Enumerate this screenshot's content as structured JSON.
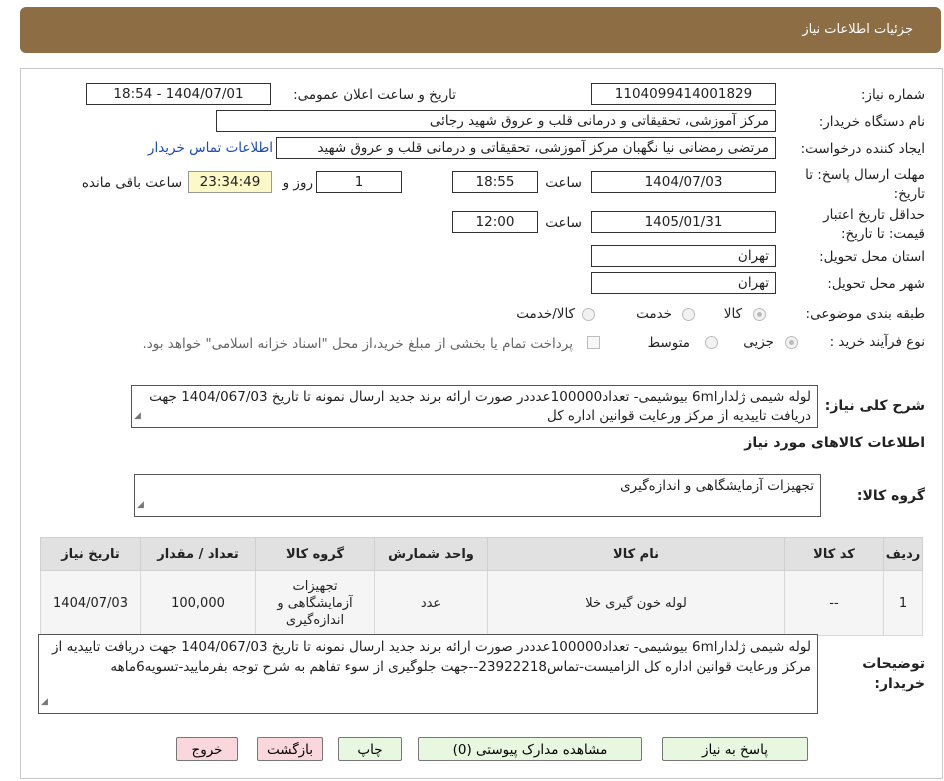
{
  "header": {
    "title": "جزئيات اطلاعات نياز"
  },
  "fields": {
    "need_number": {
      "label": "شماره نیاز:",
      "value": "1104099414001829"
    },
    "announce_datetime": {
      "label": "تاریخ و ساعت اعلان عمومی:",
      "value": "1404/07/01 - 18:54"
    },
    "buyer_org": {
      "label": "نام دستگاه خریدار:",
      "value": "مرکز آموزشی، تحقیقاتی و درمانی قلب و عروق شهید رجائی"
    },
    "requester": {
      "label": "ایجاد کننده درخواست:",
      "value": "مرتضی رمضانی نیا نگهبان مرکز آموزشی، تحقیقاتی و درمانی قلب و عروق شهید",
      "contact_link": "اطلاعات تماس خریدار"
    },
    "deadline": {
      "label_line1": "مهلت ارسال پاسخ: تا",
      "label_line2": "تاریخ:",
      "date": "1404/07/03",
      "time_label": "ساعت",
      "time": "18:55",
      "days": "1",
      "days_label": "روز و",
      "remaining": "23:34:49",
      "remaining_label": "ساعت باقی مانده"
    },
    "validity": {
      "label_line1": "حداقل تاریخ اعتبار",
      "label_line2": "قیمت: تا تاریخ:",
      "date": "1405/01/31",
      "time_label": "ساعت",
      "time": "12:00"
    },
    "province": {
      "label": "استان محل تحویل:",
      "value": "تهران"
    },
    "city": {
      "label": "شهر محل تحویل:",
      "value": "تهران"
    },
    "category": {
      "label": "طبقه بندی موضوعی:",
      "options": [
        "کالا",
        "خدمت",
        "کالا/خدمت"
      ]
    },
    "process": {
      "label": "نوع فرآیند خرید :",
      "options": [
        "جزیی",
        "متوسط"
      ],
      "payment_note": "پرداخت تمام یا بخشی از مبلغ خرید،از محل \"اسناد خزانه اسلامی\" خواهد بود."
    }
  },
  "description": {
    "label": "شرح کلی نیاز:",
    "text": "لوله شیمی ژلدار6ml بیوشیمی- تعداد100000عدددر صورت ارائه برند جدید ارسال نمونه تا تاریخ 1404/067/03 جهت دریافت تاییدیه از مرکز ورعایت قوانین اداره کل"
  },
  "goods_section": {
    "title": "اطلاعات کالاهای مورد نیاز",
    "group_label": "گروه کالا:",
    "group_value": "تجهیزات آزمایشگاهی و اندازه‌گیری"
  },
  "table": {
    "headers": [
      "ردیف",
      "کد کالا",
      "نام کالا",
      "واحد شمارش",
      "گروه کالا",
      "تعداد / مقدار",
      "تاریخ نیاز"
    ],
    "rows": [
      {
        "row": "1",
        "code": "--",
        "name": "لوله خون گیری خلا",
        "unit": "عدد",
        "group": "تجهیزات آزمایشگاهی و اندازه‌گیری",
        "qty": "100,000",
        "date": "1404/07/03"
      }
    ]
  },
  "buyer_notes": {
    "label_line1": "توضیحات",
    "label_line2": "خریدار:",
    "text": "لوله شیمی ژلدار6ml بیوشیمی- تعداد100000عدددر صورت ارائه برند جدید ارسال نمونه تا تاریخ 1404/067/03 جهت دریافت تاییدیه از مرکز ورعایت قوانین اداره کل الزامیست-تماس23922218--جهت جلوگیری از سوء تفاهم به شرح توجه بفرمایید-تسویه6ماهه"
  },
  "buttons": {
    "reply": "پاسخ به نیاز",
    "attachments": "مشاهده مدارک پیوستی (0)",
    "print": "چاپ",
    "back": "بازگشت",
    "exit": "خروج"
  },
  "colors": {
    "header": "#8c6d44",
    "link": "#1a4ab8",
    "highlight": "#fdf8c8"
  }
}
